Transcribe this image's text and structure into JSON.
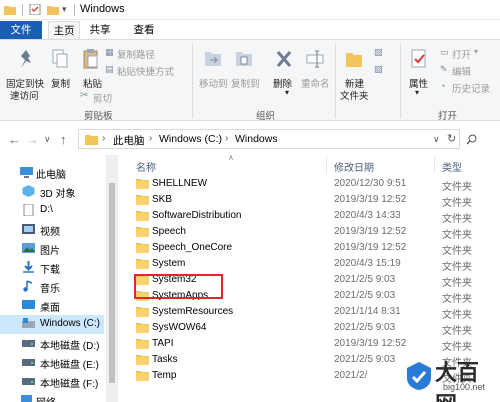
{
  "window": {
    "title": "Windows"
  },
  "ribbon_tabs": [
    "文件",
    "主页",
    "共享",
    "查看"
  ],
  "ribbon": {
    "clipboard": {
      "pin_label_1": "固定到快",
      "pin_label_2": "速访问",
      "copy": "复制",
      "paste": "粘贴",
      "copy_path": "复制路径",
      "paste_shortcut": "粘贴快捷方式",
      "cut": "剪切",
      "group": "剪贴板"
    },
    "organize": {
      "move_to": "移动到",
      "copy_to": "复制到",
      "delete": "删除",
      "rename": "重命名",
      "group": "组织"
    },
    "new": {
      "new_folder_1": "新建",
      "new_folder_2": "文件夹"
    },
    "open": {
      "properties": "属性",
      "open": "打开",
      "edit": "编辑",
      "history": "历史记录",
      "group": "打开"
    }
  },
  "address": {
    "path": [
      "此电脑",
      "Windows (C:)",
      "Windows"
    ]
  },
  "nav_pane": {
    "items": [
      "此电脑",
      "3D 对象",
      "D:\\",
      "视频",
      "图片",
      "下载",
      "音乐",
      "桌面",
      "Windows (C:)",
      "本地磁盘 (D:)",
      "本地磁盘 (E:)",
      "本地磁盘 (F:)",
      "网络"
    ],
    "selected": "Windows (C:)"
  },
  "columns": {
    "name": "名称",
    "date": "修改日期",
    "type": "类型"
  },
  "files": [
    {
      "name": "SHELLNEW",
      "date": "2020/12/30 9:51",
      "type": "文件夹"
    },
    {
      "name": "SKB",
      "date": "2019/3/19 12:52",
      "type": "文件夹"
    },
    {
      "name": "SoftwareDistribution",
      "date": "2020/4/3 14:33",
      "type": "文件夹"
    },
    {
      "name": "Speech",
      "date": "2019/3/19 12:52",
      "type": "文件夹"
    },
    {
      "name": "Speech_OneCore",
      "date": "2019/3/19 12:52",
      "type": "文件夹"
    },
    {
      "name": "System",
      "date": "2020/4/3 15:19",
      "type": "文件夹"
    },
    {
      "name": "System32",
      "date": "2021/2/5 9:03",
      "type": "文件夹"
    },
    {
      "name": "SystemApps",
      "date": "2021/2/5 9:03",
      "type": "文件夹"
    },
    {
      "name": "SystemResources",
      "date": "2021/1/14 8:31",
      "type": "文件夹"
    },
    {
      "name": "SysWOW64",
      "date": "2021/2/5 9:03",
      "type": "文件夹"
    },
    {
      "name": "TAPI",
      "date": "2019/3/19 12:52",
      "type": "文件夹"
    },
    {
      "name": "Tasks",
      "date": "2021/2/5 9:03",
      "type": "文件夹"
    },
    {
      "name": "Temp",
      "date": "2021/2/",
      "type": "文件夹"
    }
  ],
  "watermark": {
    "title": "大百网",
    "url": "big100.net"
  },
  "colors": {
    "accent": "#1a5fb4",
    "folder": "#f2c55c",
    "highlight": "#e0262a",
    "selected": "#cce8ff"
  }
}
